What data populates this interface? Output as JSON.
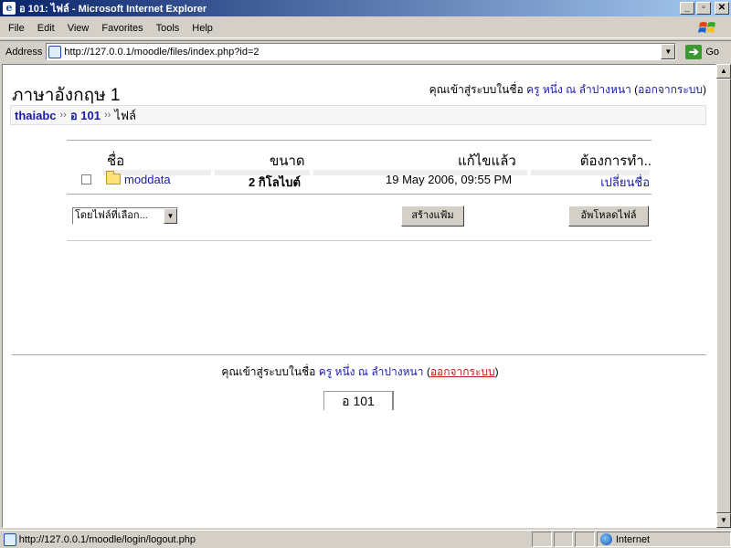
{
  "window": {
    "title": "อ 101: ไฟล์ - Microsoft Internet Explorer",
    "app_icon": "e",
    "controls": [
      "_",
      "▫",
      "✕"
    ]
  },
  "menu": [
    "File",
    "Edit",
    "View",
    "Favorites",
    "Tools",
    "Help"
  ],
  "address": {
    "label": "Address",
    "url": "http://127.0.0.1/moodle/files/index.php?id=2",
    "go_label": "Go",
    "go_icon": "➔"
  },
  "page": {
    "course_title": "ภาษาอังกฤษ 1",
    "login": {
      "prefix": "คุณเข้าสู่ระบบในชื่อ",
      "user": "ครู หนึ่ง ณ ลำปางหนา",
      "open": "(",
      "logout": "ออกจากระบบ",
      "close": ")"
    },
    "breadcrumb": [
      {
        "label": "thaiabc"
      },
      {
        "label": "อ 101"
      },
      {
        "label": "ไฟล์"
      }
    ],
    "breadcrumb_sep": "››",
    "table": {
      "headers": {
        "name": "ชื่อ",
        "size": "ขนาด",
        "modified": "แก้ไขแล้ว",
        "action": "ต้องการทำ.."
      },
      "rows": [
        {
          "name": "moddata",
          "size": "2 กิโลไบต์",
          "modified": "19 May 2006, 09:55 PM",
          "action": "เปลี่ยนชื่อ"
        }
      ]
    },
    "controls": {
      "select_label": "โดยไฟล์ที่เลือก...",
      "mkdir_label": "สร้างแฟ้ม",
      "upload_label": "อัพโหลดไฟล์"
    },
    "footer_course": "อ 101"
  },
  "status": {
    "text": "http://127.0.0.1/moodle/login/logout.php",
    "zone": "Internet"
  },
  "colors": {
    "link": "#1a1aa8",
    "logout_red": "#c81a1a",
    "titlebar": "#0a246a"
  }
}
